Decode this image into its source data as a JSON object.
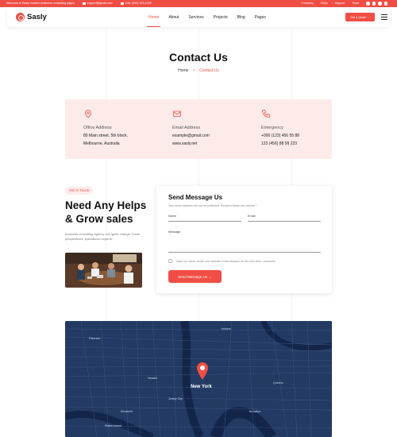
{
  "topbar": {
    "welcome": "Welcome to Sasly, modern business consulting pages",
    "email": "support@gmail.com",
    "phone": "Call: (000) 123-4189",
    "links": [
      "Company",
      "FAQs",
      "Support",
      "Team"
    ]
  },
  "header": {
    "logo_text": "Sasly",
    "nav": [
      "Home",
      "About",
      "Services",
      "Projects",
      "Blog",
      "Pages"
    ],
    "active_nav": "Home",
    "quote_label": "Get a Quote →"
  },
  "page": {
    "title": "Contact Us",
    "breadcrumb": {
      "home": "Home",
      "separator": "•",
      "current": "Contact Us"
    }
  },
  "info": [
    {
      "icon": "map-pin-icon",
      "title": "Office Address",
      "lines": [
        "80 Main street, 5th block,",
        "Melbourne, Australia"
      ]
    },
    {
      "icon": "email-icon",
      "title": "Email Address",
      "lines": [
        "example@gmail.com",
        "www.sasly.net"
      ]
    },
    {
      "icon": "phone-icon",
      "title": "Emergency",
      "lines": [
        "+000 (123) 456 55 88",
        "123 (456) 88 99 223"
      ]
    }
  ],
  "intro": {
    "tag": "Get In Touch",
    "heading": "Need Any Helps & Grow sales",
    "description": "Business consulting agency can ignite change. Fresh perspectives, specialized experts."
  },
  "form": {
    "title": "Send Message Us",
    "subtitle": "Your email address will not be published. Required fields are marked *",
    "name_label": "Name",
    "email_label": "Email",
    "message_label": "Message",
    "consent_label": "Save my name, email, and website in this browser for the next time I comment.",
    "submit_label": "Send Message Us →"
  },
  "map": {
    "city_label": "New York",
    "labels": [
      "Newark",
      "Brooklyn",
      "Queens",
      "Yonkers",
      "Jersey City",
      "Staten Island",
      "Paterson",
      "Elizabeth"
    ]
  },
  "colors": {
    "accent": "#f04e45",
    "soft_accent": "#fdebea",
    "map_bg": "#233a63"
  }
}
